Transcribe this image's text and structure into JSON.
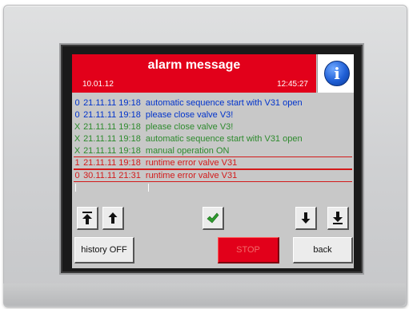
{
  "header": {
    "title": "alarm message",
    "date": "10.01.12",
    "time": "12:45:27",
    "info_icon": "info-icon",
    "info_glyph": "i"
  },
  "alarms": [
    {
      "code": "0",
      "datetime": "21.11.11 19:18",
      "text": "automatic sequence start with V31 open",
      "color": "#0033cc"
    },
    {
      "code": "0",
      "datetime": "21.11.11 19:18",
      "text": "please close valve V3!",
      "color": "#0033cc"
    },
    {
      "code": "X",
      "datetime": "21.11.11 19:18",
      "text": "please close valve V3!",
      "color": "#2d8a2d"
    },
    {
      "code": "X",
      "datetime": "21.11.11 19:18",
      "text": "automatic sequence start with V31 open",
      "color": "#2d8a2d"
    },
    {
      "code": "X",
      "datetime": "21.11.11 19:18",
      "text": "manual operation ON",
      "color": "#2d8a2d"
    },
    {
      "code": "1",
      "datetime": "21.11.11 19:18",
      "text": "runtime error valve V31",
      "color": "#d31a1a"
    },
    {
      "code": "0",
      "datetime": "30.11.11 21:31",
      "text": "runtime error valve V31",
      "color": "#d31a1a"
    }
  ],
  "nav_icons": {
    "first": "arrow-to-top-icon",
    "up": "arrow-up-icon",
    "confirm": "checkmark-icon",
    "down": "arrow-down-icon",
    "last": "arrow-to-bottom-icon"
  },
  "buttons": {
    "history": "history OFF",
    "stop": "STOP",
    "back": "back"
  },
  "colors": {
    "header_red": "#e2001a",
    "screen_grey": "#c8c8c8",
    "check_green": "#2e9a2e"
  }
}
